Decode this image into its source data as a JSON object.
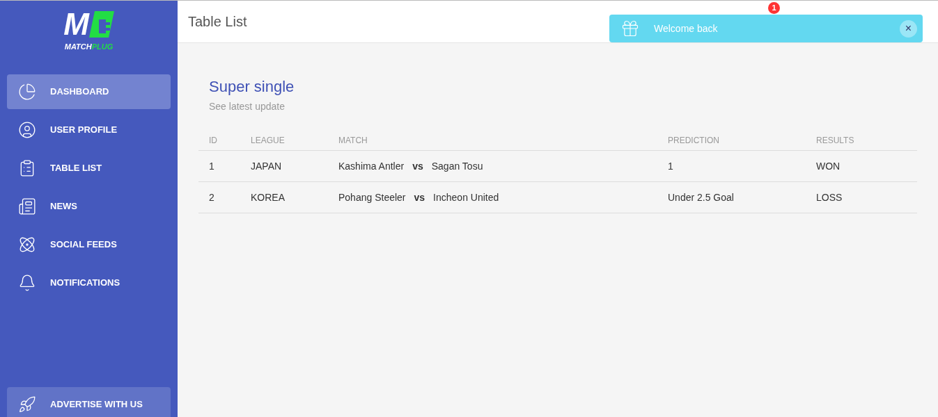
{
  "logo": {
    "letter": "M",
    "word_part_1": "MATCH",
    "word_part_2": "PLUG"
  },
  "sidebar": {
    "items": [
      {
        "label": "DASHBOARD",
        "selected": true
      },
      {
        "label": "USER PROFILE",
        "selected": false
      },
      {
        "label": "TABLE LIST",
        "selected": false
      },
      {
        "label": "NEWS",
        "selected": false
      },
      {
        "label": "SOCIAL FEEDS",
        "selected": false
      },
      {
        "label": "NOTIFICATIONS",
        "selected": false
      }
    ],
    "bottom_button": {
      "label": "ADVERTISE WITH US"
    }
  },
  "header": {
    "title": "Table List",
    "notification_badge": "1"
  },
  "toast": {
    "message": "Welcome back",
    "close": "×"
  },
  "card": {
    "title": "Super single",
    "subtitle": "See latest update",
    "table": {
      "columns": [
        "ID",
        "LEAGUE",
        "MATCH",
        "PREDICTION",
        "RESULTS"
      ],
      "rows": [
        {
          "id": "1",
          "league": "JAPAN",
          "home": "Kashima Antler",
          "vs": "vs",
          "away": "Sagan Tosu",
          "prediction": "1",
          "result": "WON"
        },
        {
          "id": "2",
          "league": "KOREA",
          "home": "Pohang Steeler",
          "vs": "vs",
          "away": "Incheon United",
          "prediction": "Under 2.5 Goal",
          "result": "LOSS"
        }
      ]
    }
  }
}
